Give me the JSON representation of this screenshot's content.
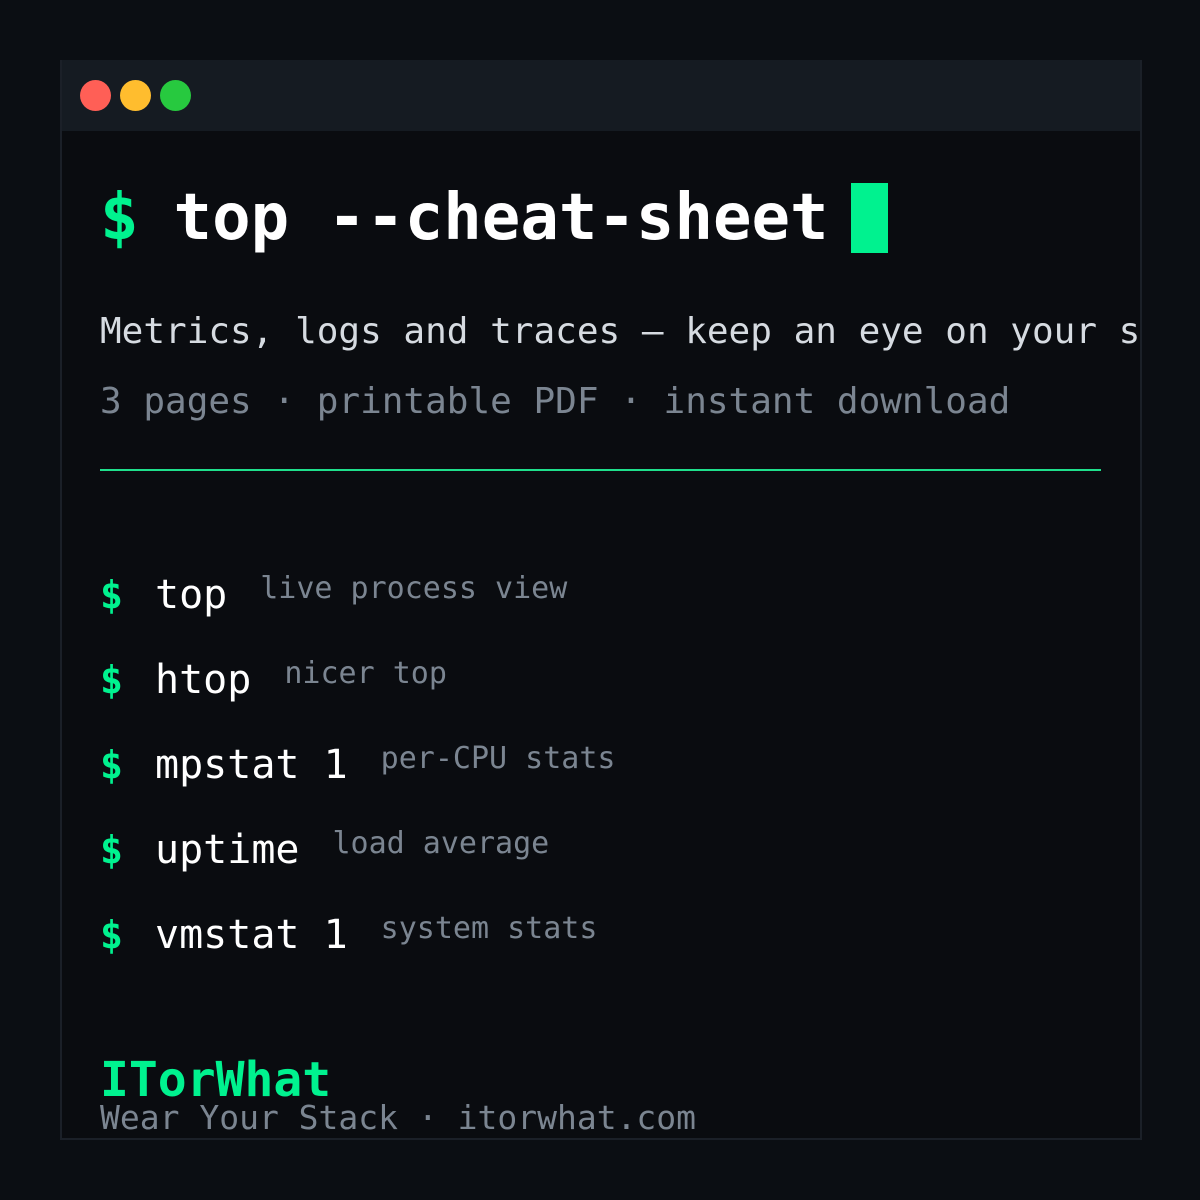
{
  "window": {
    "controls": [
      "close",
      "minimize",
      "maximize"
    ]
  },
  "headline": {
    "prompt": "$",
    "command": "top --cheat-sheet"
  },
  "subtitle": "Metrics, logs and traces — keep an eye on your systems",
  "meta": "3 pages · printable PDF · instant download",
  "commands": [
    {
      "prompt": "$",
      "command": "top",
      "description": "live process view"
    },
    {
      "prompt": "$",
      "command": "htop",
      "description": "nicer top"
    },
    {
      "prompt": "$",
      "command": "mpstat 1",
      "description": "per-CPU stats"
    },
    {
      "prompt": "$",
      "command": "uptime",
      "description": "load average"
    },
    {
      "prompt": "$",
      "command": "vmstat 1",
      "description": "system stats"
    }
  ],
  "footer": {
    "brand": "ITorWhat",
    "tagline": "Wear Your Stack · itorwhat.com"
  },
  "colors": {
    "accent": "#00f28f",
    "background": "#0a0c10",
    "titlebar": "#151b22",
    "muted": "#7b8591",
    "close": "#ff5f56",
    "minimize": "#ffbd2e",
    "maximize": "#27c93f"
  }
}
